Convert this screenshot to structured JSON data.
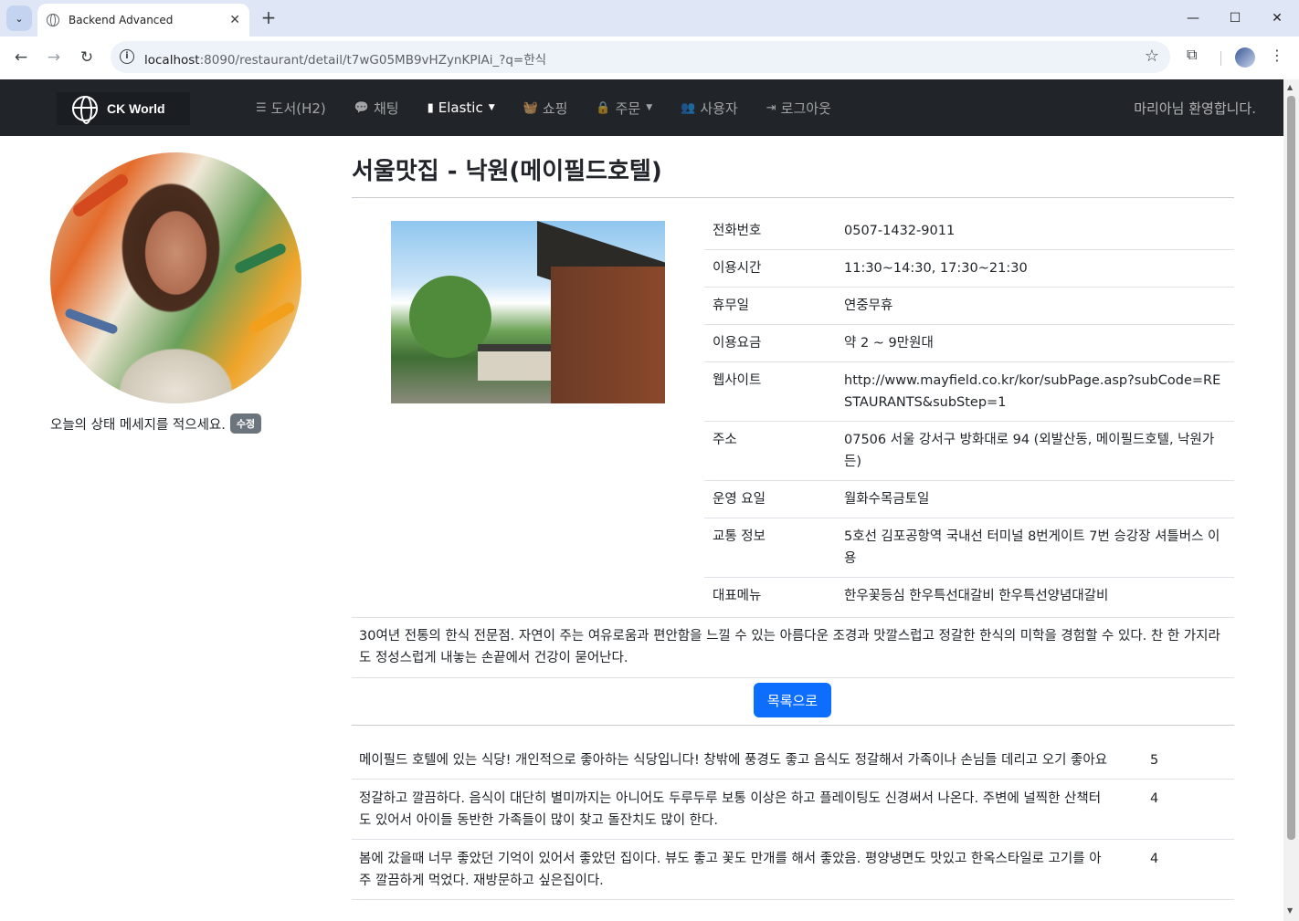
{
  "browser": {
    "tab_title": "Backend Advanced",
    "url_host": "localhost",
    "url_rest": ":8090/restaurant/detail/t7wG05MB9vHZynKPIAi_?q=한식",
    "new_tab": "+",
    "win_min": "—",
    "win_max": "☐",
    "win_close": "✕"
  },
  "navbar": {
    "brand": "CK World",
    "items": [
      {
        "icon": "list-icon",
        "glyph": "☰",
        "label": "도서(H2)",
        "dropdown": false,
        "active": false
      },
      {
        "icon": "comments-icon",
        "glyph": "💬",
        "label": "채팅",
        "dropdown": false,
        "active": false
      },
      {
        "icon": "book-icon",
        "glyph": "▮",
        "label": "Elastic",
        "dropdown": true,
        "active": true
      },
      {
        "icon": "basket-icon",
        "glyph": "🧺",
        "label": "쇼핑",
        "dropdown": false,
        "active": false
      },
      {
        "icon": "lock-icon",
        "glyph": "🔒",
        "label": "주문",
        "dropdown": true,
        "active": false
      },
      {
        "icon": "users-icon",
        "glyph": "👥",
        "label": "사용자",
        "dropdown": false,
        "active": false
      },
      {
        "icon": "logout-icon",
        "glyph": "⇥",
        "label": "로그아웃",
        "dropdown": false,
        "active": false
      }
    ],
    "welcome": "마리아님 환영합니다."
  },
  "sidebar": {
    "status_message": "오늘의 상태 메세지를 적으세요.",
    "edit_label": "수정"
  },
  "restaurant": {
    "title": "서울맛집 - 낙원(메이필드호텔)",
    "info": [
      {
        "key": "전화번호",
        "value": "0507-1432-9011"
      },
      {
        "key": "이용시간",
        "value": "11:30~14:30, 17:30~21:30"
      },
      {
        "key": "휴무일",
        "value": "연중무휴"
      },
      {
        "key": "이용요금",
        "value": "약 2 ~ 9만원대"
      },
      {
        "key": "웹사이트",
        "value": "http://www.mayfield.co.kr/kor/subPage.asp?subCode=RESTAURANTS&subStep=1"
      },
      {
        "key": "주소",
        "value": "07506 서울 강서구 방화대로 94 (외발산동, 메이필드호텔, 낙원가든)"
      },
      {
        "key": "운영 요일",
        "value": "월화수목금토일"
      },
      {
        "key": "교통 정보",
        "value": "5호선 김포공항역 국내선 터미널 8번게이트 7번 승강장 셔틀버스 이용"
      },
      {
        "key": "대표메뉴",
        "value": "한우꽃등심 한우특선대갈비 한우특선양념대갈비"
      }
    ],
    "description": "30여년 전통의 한식 전문점. 자연이 주는 여유로움과 편안함을 느낄 수 있는 아름다운 조경과 맛깔스럽고 정갈한 한식의 미학을 경험할 수 있다. 찬 한 가지라도 정성스럽게 내놓는 손끝에서 건강이 묻어난다.",
    "back_button": "목록으로"
  },
  "reviews": [
    {
      "text": "메이필드 호텔에 있는 식당! 개인적으로 좋아하는 식당입니다! 창밖에 풍경도 좋고 음식도 정갈해서 가족이나 손님들 데리고 오기 좋아요",
      "score": "5"
    },
    {
      "text": "정갈하고 깔끔하다. 음식이 대단히 별미까지는 아니어도 두루두루 보통 이상은 하고 플레이팅도 신경써서 나온다. 주변에 널찍한 산책터도 있어서 아이들 동반한 가족들이 많이 찾고 돌잔치도 많이 한다.",
      "score": "4"
    },
    {
      "text": "봄에 갔을때 너무 좋았던 기억이 있어서 좋았던 집이다. 뷰도 좋고 꽃도 만개를 해서 좋았음. 평양냉면도 맛있고 한옥스타일로 고기를 아주 깔끔하게 먹었다. 재방문하고 싶은집이다.",
      "score": "4"
    }
  ]
}
